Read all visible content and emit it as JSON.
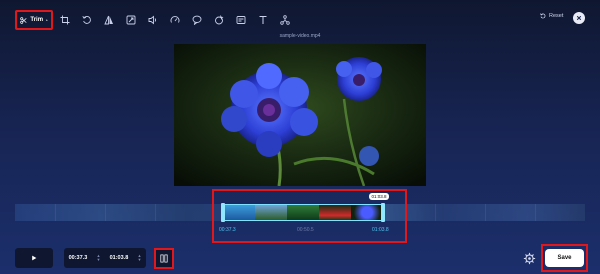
{
  "toolbar": {
    "trim_label": "Trim",
    "trim_marker": "*",
    "tools": [
      "crop-icon",
      "rotate-icon",
      "flip-icon",
      "resize-icon",
      "volume-icon",
      "speed-icon",
      "subtitle-icon",
      "filter-icon",
      "text-icon",
      "merge-icon"
    ],
    "reset_label": "Reset"
  },
  "preview": {
    "filename": "sample-video.mp4"
  },
  "timeline": {
    "bubble_time": "01:03.8",
    "start_label": "00:37.3",
    "mid_label": "00:50.5",
    "end_label": "01:03.8"
  },
  "controls": {
    "start_time": "00:37.3",
    "end_time": "01:03.8",
    "save_label": "Save"
  },
  "colors": {
    "highlight": "#e0181c",
    "accent": "#4fc6f2"
  }
}
